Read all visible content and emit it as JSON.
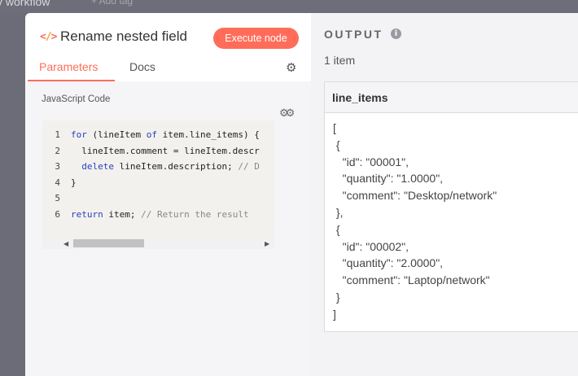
{
  "background": {
    "workflow_name": "y workflow",
    "add_tag": "+ Add tag"
  },
  "node": {
    "title": "Rename nested field",
    "execute_button": "Execute node",
    "tabs": [
      "Parameters",
      "Docs"
    ],
    "active_tab": "Parameters"
  },
  "parameters": {
    "code_label": "JavaScript Code",
    "line_numbers": [
      "1",
      "2",
      "3",
      "4",
      "5",
      "6"
    ],
    "code_lines": [
      "for (lineItem of item.line_items) {",
      "  lineItem.comment = lineItem.descr",
      "  delete lineItem.description; // D",
      "}",
      "",
      "return item; // Return the result"
    ]
  },
  "output": {
    "title": "OUTPUT",
    "item_count": "1 item",
    "column": "line_items",
    "json_lines": [
      "[",
      " {",
      "   \"id\": \"00001\",",
      "   \"quantity\": \"1.0000\",",
      "   \"comment\": \"Desktop/network\"",
      " },",
      " {",
      "   \"id\": \"00002\",",
      "   \"quantity\": \"2.0000\",",
      "   \"comment\": \"Laptop/network\"",
      " }",
      "]"
    ]
  },
  "colors": {
    "accent": "#ff6d5a",
    "backdrop": "#6c6c78"
  }
}
